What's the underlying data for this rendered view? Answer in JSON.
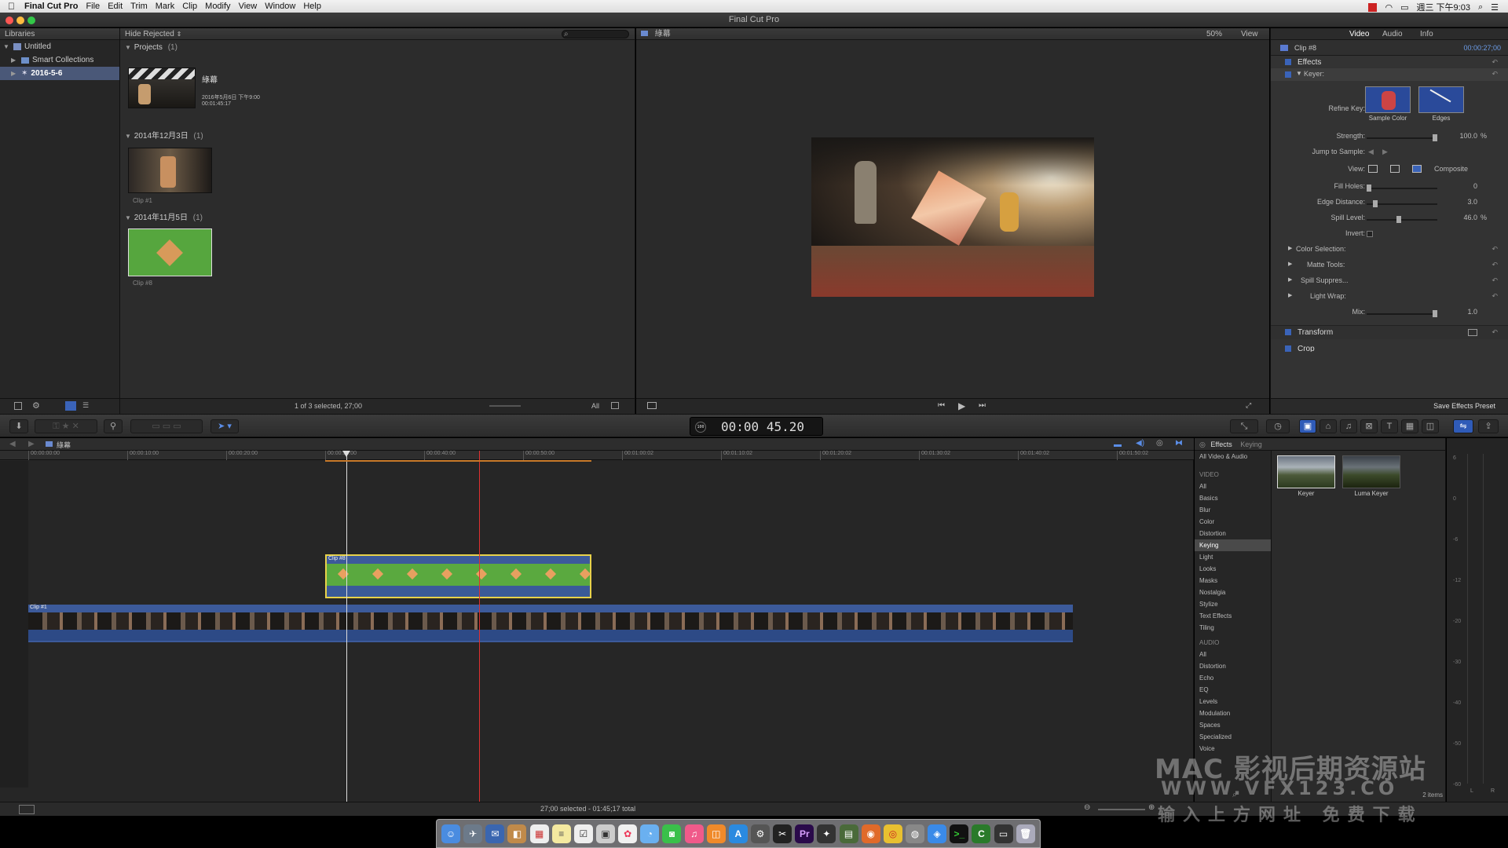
{
  "menubar": {
    "apple": "",
    "app": "Final Cut Pro",
    "items": [
      "File",
      "Edit",
      "Trim",
      "Mark",
      "Clip",
      "Modify",
      "View",
      "Window",
      "Help"
    ],
    "clock": "週三 下午9:03"
  },
  "window": {
    "title": "Final Cut Pro"
  },
  "libraries": {
    "header": "Libraries",
    "items": [
      {
        "label": "Untitled"
      },
      {
        "label": "Smart Collections"
      },
      {
        "label": "2016-5-6"
      }
    ]
  },
  "browser": {
    "filter": "Hide Rejected",
    "search_placeholder": "",
    "groups": [
      {
        "title": "Projects",
        "count": "(1)"
      },
      {
        "title": "2014年12月3日",
        "count": "(1)"
      },
      {
        "title": "2014年11月5日",
        "count": "(1)"
      }
    ],
    "project": {
      "name": "綠幕",
      "date": "2016年5月6日 下午9:00",
      "duration": "00:01:45:17"
    },
    "clip1_label": "Clip #1",
    "clip8_label": "Clip #8",
    "status": "1 of 3 selected, 27;00",
    "all": "All"
  },
  "viewer": {
    "title": "綠幕",
    "zoom": "50%",
    "view": "View"
  },
  "inspector": {
    "tabs": [
      "Video",
      "Audio",
      "Info"
    ],
    "clip": "Clip #8",
    "timecode": "00:00:27;00",
    "effects": "Effects",
    "keyer": "Keyer:",
    "refine_key": "Refine Key:",
    "sample_color": "Sample Color",
    "edges": "Edges",
    "strength_label": "Strength:",
    "strength_value": "100.0",
    "strength_unit": "%",
    "jump_label": "Jump to Sample:",
    "view_label": "View:",
    "composite": "Composite",
    "fill_holes_label": "Fill Holes:",
    "fill_holes_value": "0",
    "edge_distance_label": "Edge Distance:",
    "edge_distance_value": "3.0",
    "spill_level_label": "Spill Level:",
    "spill_level_value": "46.0",
    "spill_unit": "%",
    "invert_label": "Invert:",
    "color_selection": "Color Selection:",
    "matte_tools": "Matte Tools:",
    "spill_suppress": "Spill Suppres...",
    "light_wrap": "Light Wrap:",
    "mix_label": "Mix:",
    "mix_value": "1.0",
    "transform": "Transform",
    "crop": "Crop",
    "save_preset": "Save Effects Preset"
  },
  "toolbar": {
    "timecode": "00:00 45.20",
    "tc_badge": "100"
  },
  "timeline": {
    "project": "綠幕",
    "ruler": [
      "00:00:00:00",
      "00:00:10:00",
      "00:00:20:00",
      "00:00:30:00",
      "00:00:40:00",
      "00:00:50:00",
      "00:01:00:02",
      "00:01:10:02",
      "00:01:20:02",
      "00:01:30:02",
      "00:01:40:02",
      "00:01:50:02"
    ],
    "clip8": "Clip #8",
    "clip1": "Clip #1",
    "status": "27;00 selected - 01:45;17 total"
  },
  "effects_browser": {
    "tabs": [
      "Effects",
      "Keying"
    ],
    "all": "All Video & Audio",
    "video_head": "VIDEO",
    "video": [
      "All",
      "Basics",
      "Blur",
      "Color",
      "Distortion",
      "Keying",
      "Light",
      "Looks",
      "Masks",
      "Nostalgia",
      "Stylize",
      "Text Effects",
      "Tiling"
    ],
    "selected": "Keying",
    "audio_head": "AUDIO",
    "audio": [
      "All",
      "Distortion",
      "Echo",
      "EQ",
      "Levels",
      "Modulation",
      "Spaces",
      "Specialized",
      "Voice"
    ],
    "fx": [
      "Keyer",
      "Luma Keyer"
    ],
    "items_count": "2 items"
  },
  "audio_meter": {
    "marks": [
      "6",
      "0",
      "-6",
      "-12",
      "-20",
      "-30",
      "-40",
      "-50",
      "-60"
    ],
    "lr": [
      "L",
      "R"
    ]
  },
  "watermark": {
    "line1": "MAC 影视后期资源站",
    "line2": "WWW.VFX123.CO",
    "line3": "输入上方网址 免费下载"
  },
  "colors": {
    "accent": "#4a5878",
    "clip_green": "#5fa83f",
    "clip_blue": "#3c5a9a",
    "playhead": "#e03030"
  }
}
